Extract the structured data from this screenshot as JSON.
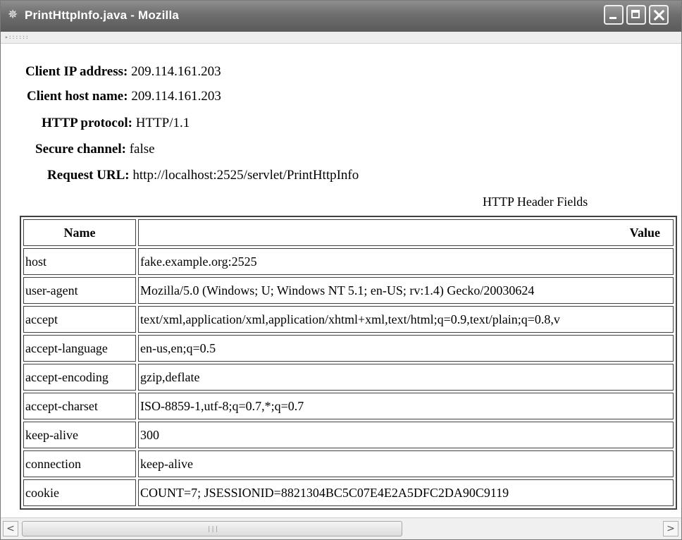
{
  "window": {
    "title": "PrintHttpInfo.java - Mozilla",
    "icon": "mozilla-icon",
    "controls": [
      "minimize",
      "maximize",
      "close"
    ]
  },
  "request_info": [
    {
      "label": "Client IP address:",
      "value": "209.114.161.203"
    },
    {
      "label": "Client host name:",
      "value": "209.114.161.203"
    },
    {
      "label": "HTTP protocol:",
      "value": "HTTP/1.1"
    },
    {
      "label": "Secure channel:",
      "value": "false"
    },
    {
      "label": "Request URL:",
      "value": "http://localhost:2525/servlet/PrintHttpInfo"
    }
  ],
  "headers_table": {
    "caption": "HTTP Header Fields",
    "columns": [
      "Name",
      "Value"
    ],
    "rows": [
      {
        "name": "host",
        "value": "fake.example.org:2525"
      },
      {
        "name": "user-agent",
        "value": "Mozilla/5.0 (Windows; U; Windows NT 5.1; en-US; rv:1.4) Gecko/20030624"
      },
      {
        "name": "accept",
        "value": "text/xml,application/xml,application/xhtml+xml,text/html;q=0.9,text/plain;q=0.8,v"
      },
      {
        "name": "accept-language",
        "value": "en-us,en;q=0.5"
      },
      {
        "name": "accept-encoding",
        "value": "gzip,deflate"
      },
      {
        "name": "accept-charset",
        "value": "ISO-8859-1,utf-8;q=0.7,*;q=0.7"
      },
      {
        "name": "keep-alive",
        "value": "300"
      },
      {
        "name": "connection",
        "value": "keep-alive"
      },
      {
        "name": "cookie",
        "value": "COUNT=7; JSESSIONID=8821304BC5C07E4E2A5DFC2DA90C9119"
      }
    ]
  },
  "scrollbar": {
    "left_arrow": "<",
    "right_arrow": ">"
  }
}
